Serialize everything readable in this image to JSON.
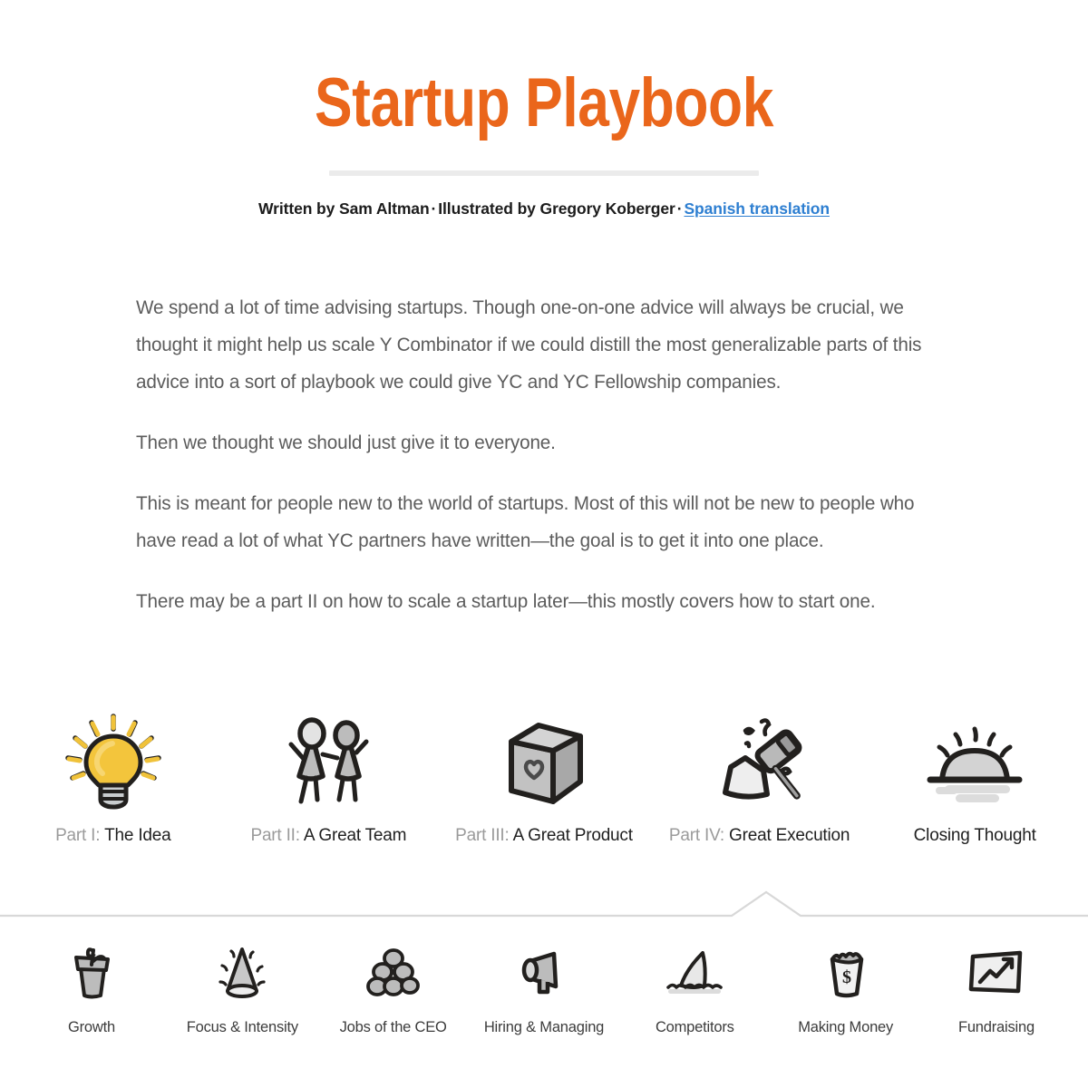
{
  "header": {
    "title": "Startup Playbook",
    "title_color": "#ea661b",
    "byline": {
      "written_by": "Written by Sam Altman",
      "separator_1": "·",
      "illustrated_by": "Illustrated by Gregory Koberger",
      "separator_2": "·",
      "translation_link": "Spanish translation",
      "link_color": "#2e7fd1"
    }
  },
  "intro": {
    "paragraphs": [
      "We spend a lot of time advising startups. Though one-on-one advice will always be crucial, we thought it might help us scale Y Combinator if we could distill the most generalizable parts of this advice into a sort of playbook we could give YC and YC Fellowship companies.",
      "Then we thought we should just give it to everyone.",
      "This is meant for people new to the world of startups. Most of this will not be new to people who have read a lot of what YC partners have written—the goal is to get it into one place.",
      "There may be a part II on how to scale a startup later—this mostly covers how to start one."
    ]
  },
  "parts": [
    {
      "prefix": "Part I:",
      "title": "The Idea",
      "icon": "lightbulb-icon"
    },
    {
      "prefix": "Part II:",
      "title": "A Great Team",
      "icon": "two-people-icon"
    },
    {
      "prefix": "Part III:",
      "title": "A Great Product",
      "icon": "box-with-heart-icon"
    },
    {
      "prefix": "Part IV:",
      "title": "Great Execution",
      "icon": "hammer-and-rock-icon"
    },
    {
      "prefix": "",
      "title": "Closing Thought",
      "icon": "sunrise-icon"
    }
  ],
  "chapters": [
    {
      "label": "Growth",
      "icon": "potted-plant-icon"
    },
    {
      "label": "Focus & Intensity",
      "icon": "cone-icon"
    },
    {
      "label": "Jobs of the CEO",
      "icon": "stacked-rocks-icon"
    },
    {
      "label": "Hiring & Managing",
      "icon": "megaphone-icon"
    },
    {
      "label": "Competitors",
      "icon": "shark-fin-icon"
    },
    {
      "label": "Making Money",
      "icon": "money-cup-icon"
    },
    {
      "label": "Fundraising",
      "icon": "growth-chart-icon"
    }
  ],
  "style": {
    "background": "#ffffff",
    "rule_color": "#ebebeb",
    "divider_color": "#d8d8d8",
    "body_text_color": "#5c5c5c",
    "icon_outline": "#1f1f1f",
    "icon_fill_gray": "#bdbdbd",
    "icon_fill_yellow": "#f5c53a"
  }
}
